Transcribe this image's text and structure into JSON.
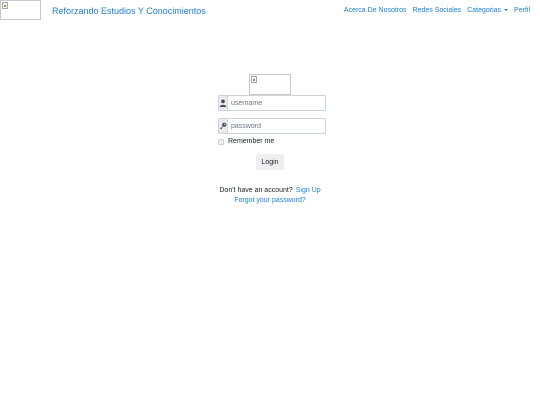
{
  "navbar": {
    "brand_title": "Reforzando Estudios Y Conocimientos",
    "links": {
      "about": "Acerca De Nosotros",
      "social": "Redes Sociales",
      "categories": "Categorias",
      "profile": "Perfil"
    }
  },
  "login": {
    "username_placeholder": "username",
    "password_placeholder": "password",
    "remember_label": "Remember me",
    "remember_checked": false,
    "submit_label": "Login",
    "no_account_text": "Don't have an account?",
    "signup_link": "Sign Up",
    "forgot_link": "Forgot your password?"
  },
  "icons": {
    "username_addon": "user-icon",
    "password_addon": "key-icon",
    "categories_dropdown": "caret-down-icon",
    "logo": "broken-image-icon"
  },
  "colors": {
    "link": "#1a7fd4",
    "addon_bg": "#e9ecef",
    "button_bg": "#efefef"
  }
}
